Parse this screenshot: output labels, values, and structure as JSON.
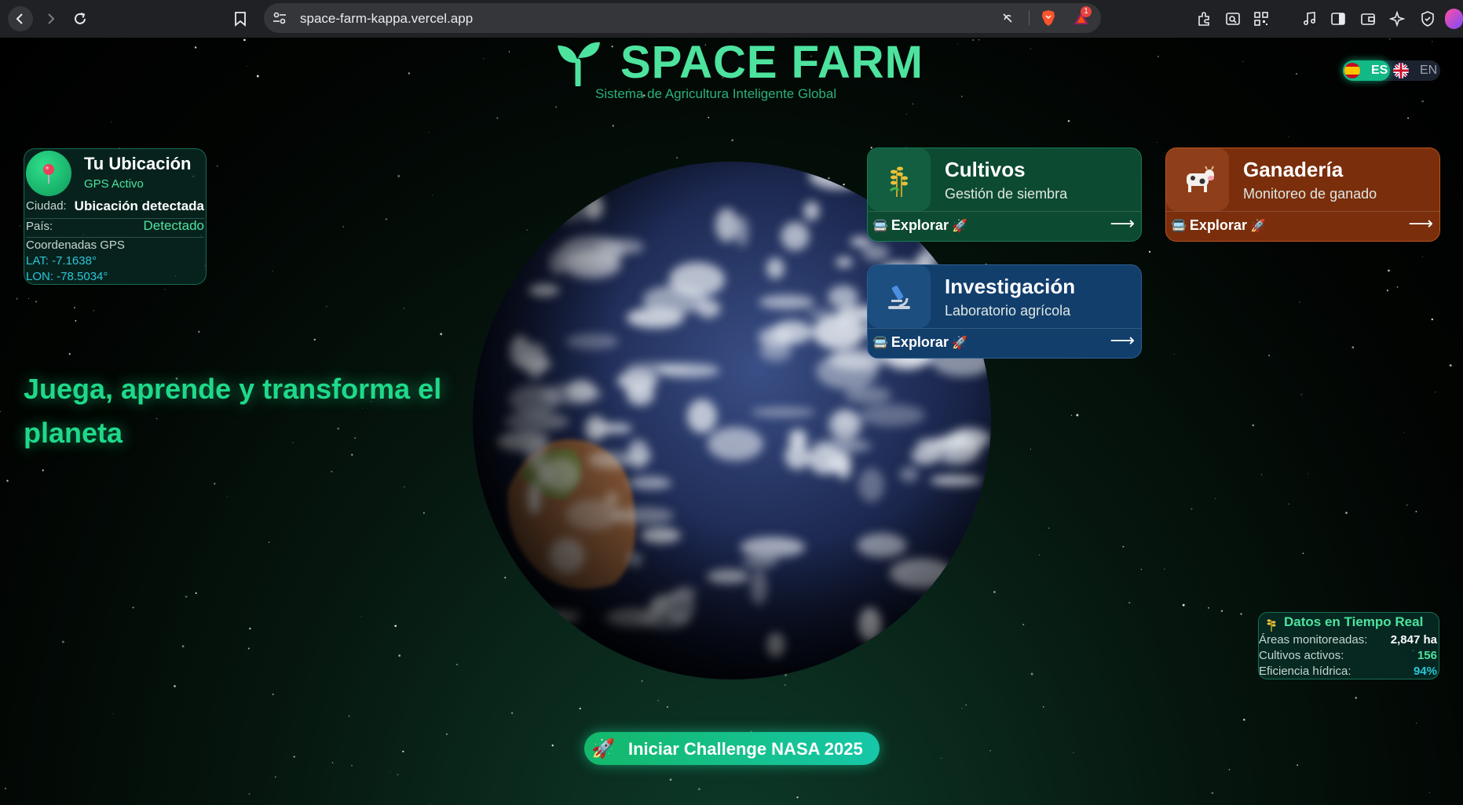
{
  "browser": {
    "url": "space-farm-kappa.vercel.app",
    "notification_count": "1"
  },
  "header": {
    "title": "SPACE FARM",
    "subtitle": "Sistema de Agricultura Inteligente Global"
  },
  "language": {
    "es_label": "ES",
    "en_label": "EN",
    "active": "ES"
  },
  "location": {
    "title": "Tu Ubicación",
    "status": "GPS Activo",
    "city_label": "Ciudad:",
    "city_value": "Ubicación detectada",
    "country_label": "País:",
    "country_value": "Detectado",
    "coords_label": "Coordenadas GPS",
    "lat": "LAT: -7.1638°",
    "lon": "LON: -78.5034°"
  },
  "tagline": "Juega, aprende y transforma el planeta",
  "cards": [
    {
      "title": "Cultivos",
      "subtitle": "Gestión de siembra",
      "action": "Explorar",
      "icon": "wheat-icon",
      "color": "#0d4a32"
    },
    {
      "title": "Ganadería",
      "subtitle": "Monitoreo de ganado",
      "action": "Explorar",
      "icon": "cow-icon",
      "color": "#7a2e0c"
    },
    {
      "title": "Investigación",
      "subtitle": "Laboratorio agrícola",
      "action": "Explorar",
      "icon": "microscope-icon",
      "color": "#123e6c"
    }
  ],
  "realtime": {
    "title": "Datos en Tiempo Real",
    "rows": [
      {
        "label": "Áreas monitoreadas:",
        "value": "2,847 ha",
        "color": "#ffffff"
      },
      {
        "label": "Cultivos activos:",
        "value": "156",
        "color": "#4de39e"
      },
      {
        "label": "Eficiencia hídrica:",
        "value": "94%",
        "color": "#2bc6d8"
      }
    ]
  },
  "cta": {
    "label": "Iniciar Challenge NASA 2025"
  },
  "colors": {
    "accent": "#4de39e",
    "accent_dark": "#1fd98a",
    "cyan": "#2bc6d8"
  }
}
